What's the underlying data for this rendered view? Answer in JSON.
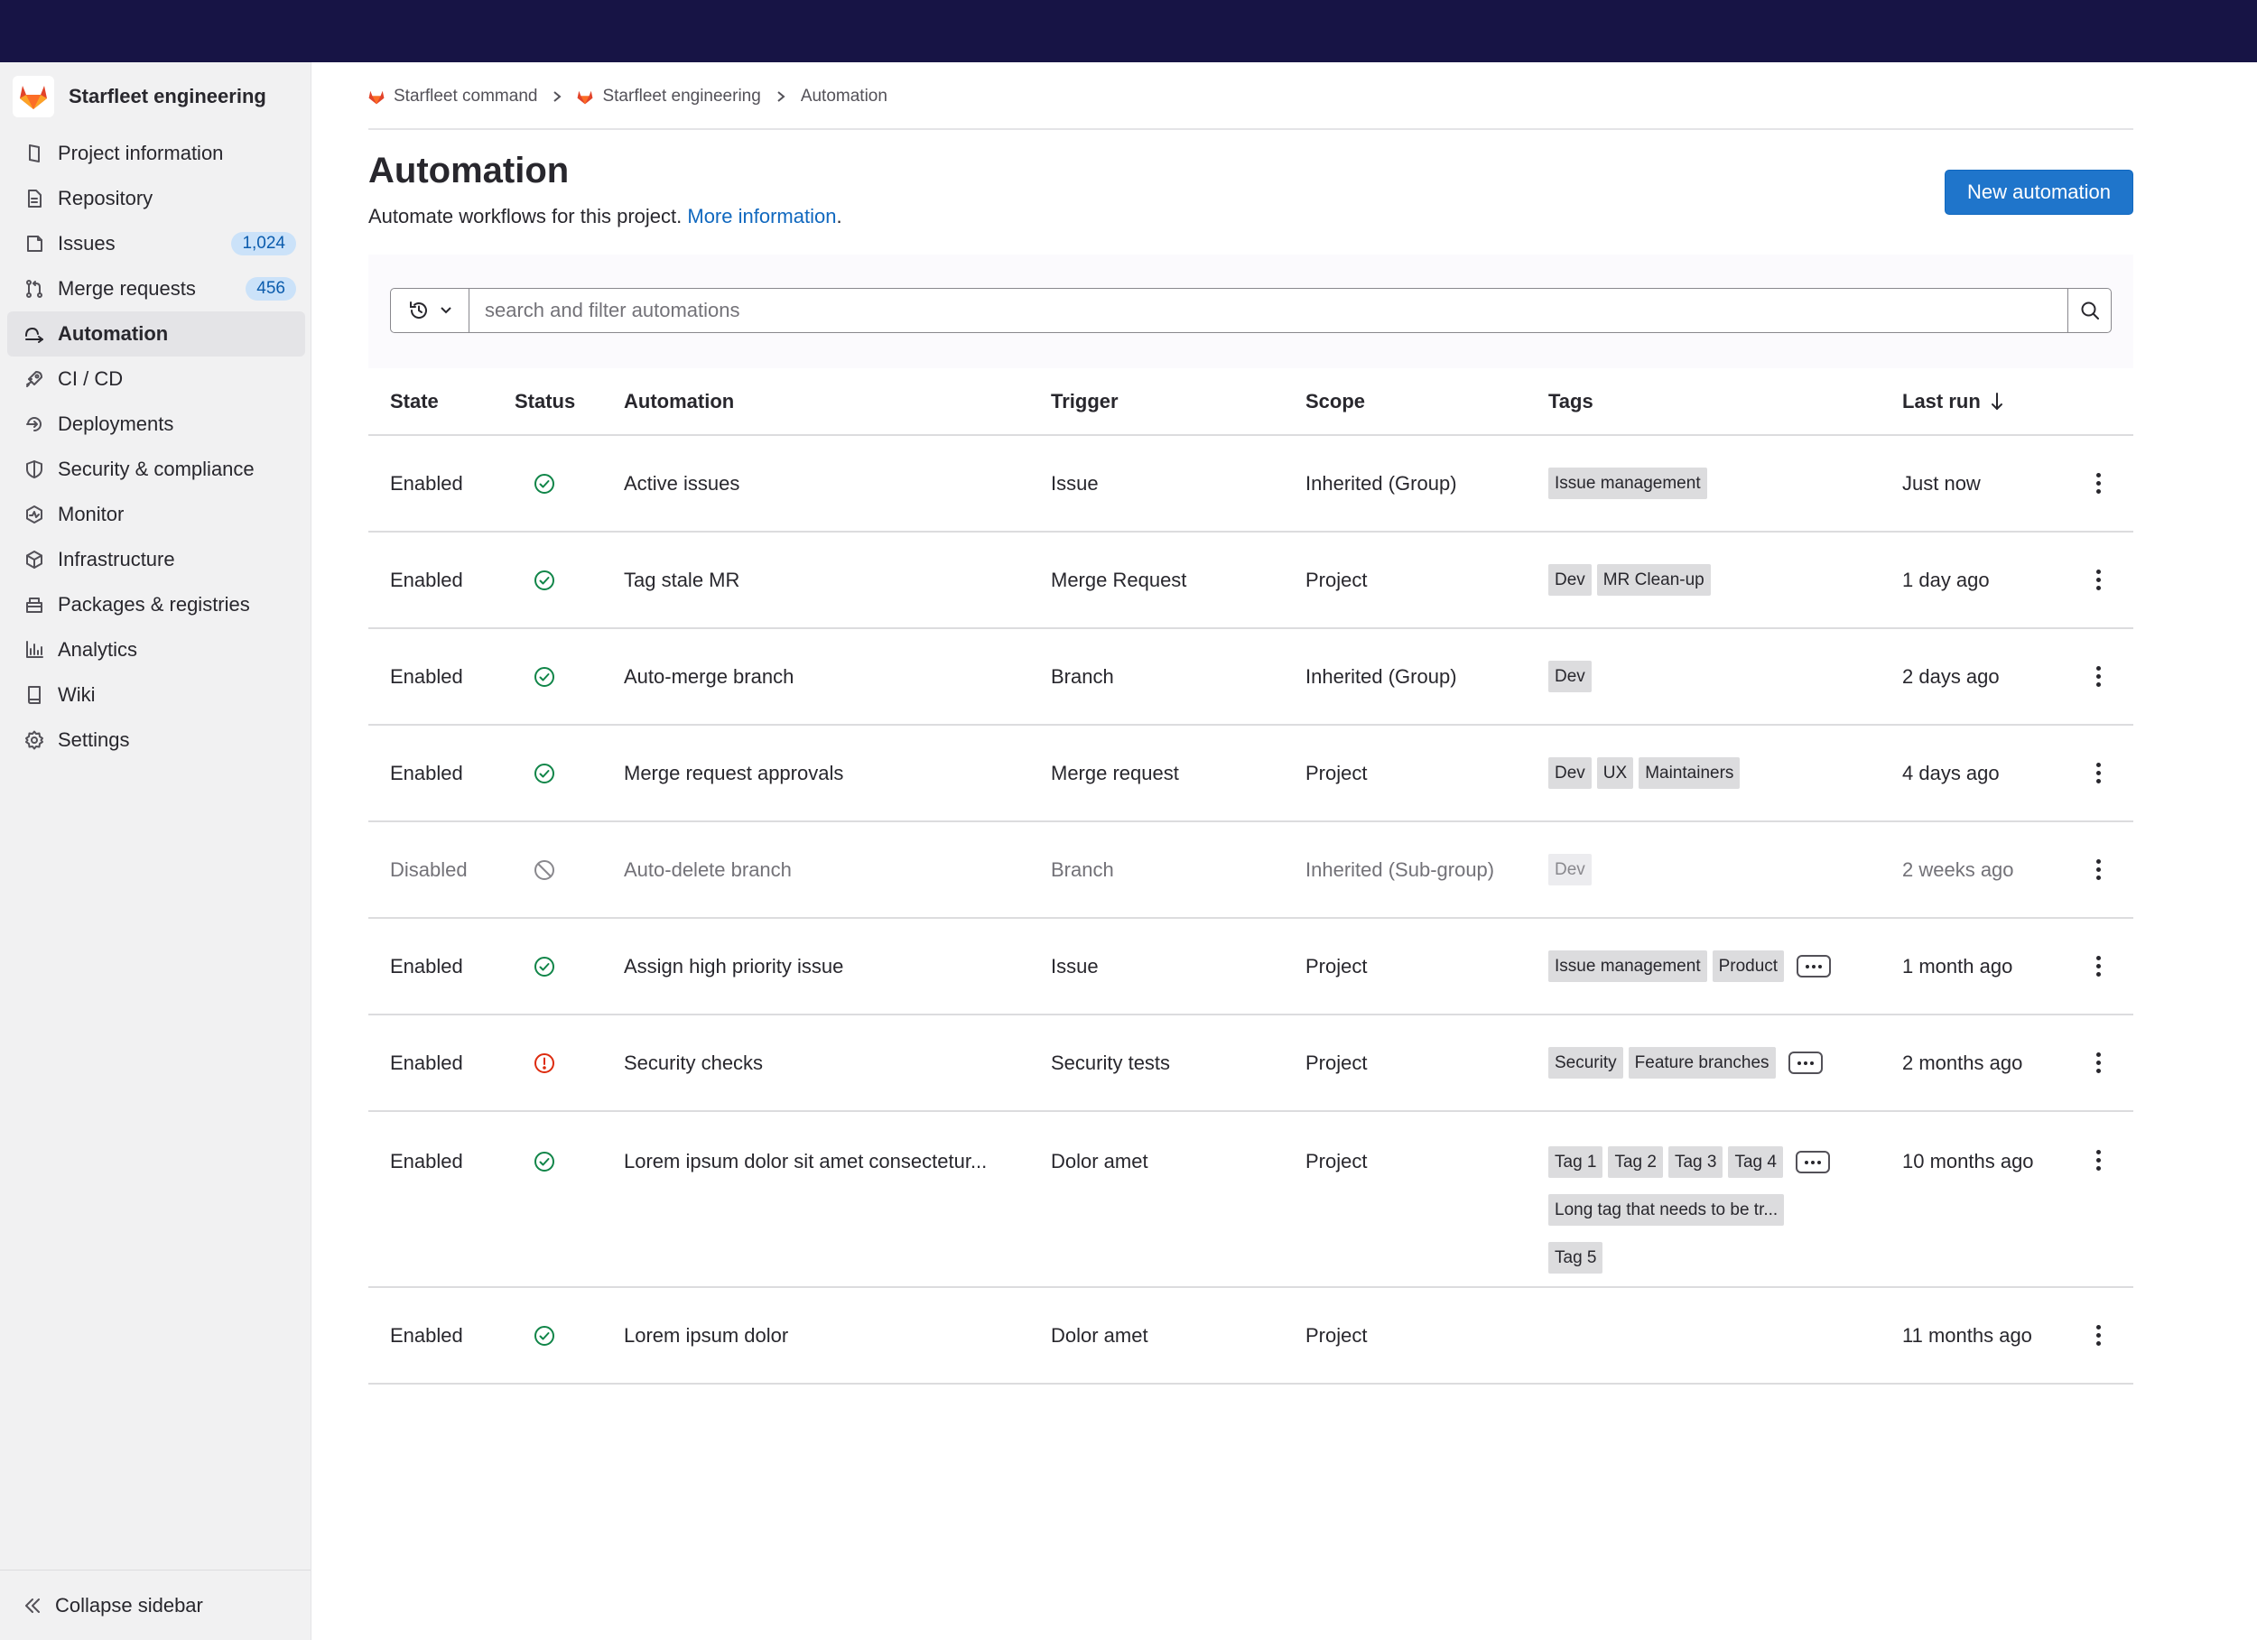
{
  "sidebar": {
    "project_name": "Starfleet engineering",
    "items": [
      {
        "label": "Project information",
        "icon": "project-icon"
      },
      {
        "label": "Repository",
        "icon": "document-icon"
      },
      {
        "label": "Issues",
        "icon": "issues-icon",
        "badge": "1,024"
      },
      {
        "label": "Merge requests",
        "icon": "merge-request-icon",
        "badge": "456"
      },
      {
        "label": "Automation",
        "icon": "automation-icon",
        "active": true
      },
      {
        "label": "CI / CD",
        "icon": "rocket-icon"
      },
      {
        "label": "Deployments",
        "icon": "deployments-icon"
      },
      {
        "label": "Security & compliance",
        "icon": "shield-icon"
      },
      {
        "label": "Monitor",
        "icon": "monitor-icon"
      },
      {
        "label": "Infrastructure",
        "icon": "infrastructure-icon"
      },
      {
        "label": "Packages & registries",
        "icon": "package-icon"
      },
      {
        "label": "Analytics",
        "icon": "chart-icon"
      },
      {
        "label": "Wiki",
        "icon": "book-icon"
      },
      {
        "label": "Settings",
        "icon": "gear-icon"
      }
    ],
    "collapse_label": "Collapse sidebar"
  },
  "breadcrumbs": [
    "Starfleet command",
    "Starfleet engineering",
    "Automation"
  ],
  "page": {
    "title": "Automation",
    "subtitle": "Automate workflows for this project.",
    "more_link": "More information",
    "subtitle_end": ".",
    "new_button": "New automation"
  },
  "search": {
    "placeholder": "search and filter automations"
  },
  "table": {
    "headers": {
      "state": "State",
      "status": "Status",
      "automation": "Automation",
      "trigger": "Trigger",
      "scope": "Scope",
      "tags": "Tags",
      "last_run": "Last run"
    },
    "rows": [
      {
        "state": "Enabled",
        "status": "success",
        "automation": "Active issues",
        "trigger": "Issue",
        "scope": "Inherited (Group)",
        "tags": [
          "Issue management"
        ],
        "more": false,
        "last_run": "Just now"
      },
      {
        "state": "Enabled",
        "status": "success",
        "automation": "Tag stale MR",
        "trigger": "Merge Request",
        "scope": "Project",
        "tags": [
          "Dev",
          "MR Clean-up"
        ],
        "more": false,
        "last_run": "1 day ago"
      },
      {
        "state": "Enabled",
        "status": "success",
        "automation": "Auto-merge branch",
        "trigger": "Branch",
        "scope": "Inherited (Group)",
        "tags": [
          "Dev"
        ],
        "more": false,
        "last_run": "2 days ago"
      },
      {
        "state": "Enabled",
        "status": "success",
        "automation": "Merge request approvals",
        "trigger": "Merge request",
        "scope": "Project",
        "tags": [
          "Dev",
          "UX",
          "Maintainers"
        ],
        "more": false,
        "last_run": "4 days ago"
      },
      {
        "state": "Disabled",
        "status": "disabled",
        "automation": "Auto-delete branch",
        "trigger": "Branch",
        "scope": "Inherited (Sub-group)",
        "tags": [
          "Dev"
        ],
        "more": false,
        "last_run": "2 weeks ago"
      },
      {
        "state": "Enabled",
        "status": "success",
        "automation": "Assign high priority issue",
        "trigger": "Issue",
        "scope": "Project",
        "tags": [
          "Issue management",
          "Product"
        ],
        "more": true,
        "last_run": "1 month ago"
      },
      {
        "state": "Enabled",
        "status": "error",
        "automation": "Security checks",
        "trigger": "Security tests",
        "scope": "Project",
        "tags": [
          "Security",
          "Feature branches"
        ],
        "more": true,
        "last_run": "2 months ago"
      },
      {
        "state": "Enabled",
        "status": "success",
        "automation": "Lorem ipsum dolor sit amet consectetur...",
        "trigger": "Dolor amet",
        "scope": "Project",
        "tags": [
          "Tag 1",
          "Tag 2",
          "Tag 3",
          "Tag 4",
          "Long tag that needs to be tr...",
          "Tag 5"
        ],
        "more": true,
        "last_run": "10 months ago"
      },
      {
        "state": "Enabled",
        "status": "success",
        "automation": "Lorem ipsum dolor",
        "trigger": "Dolor amet",
        "scope": "Project",
        "tags": [],
        "more": false,
        "last_run": "11 months ago"
      }
    ]
  },
  "colors": {
    "topbar": "#171445",
    "primary": "#1f75cb",
    "success": "#108548",
    "error": "#dd2b0e",
    "muted": "#89888d"
  }
}
